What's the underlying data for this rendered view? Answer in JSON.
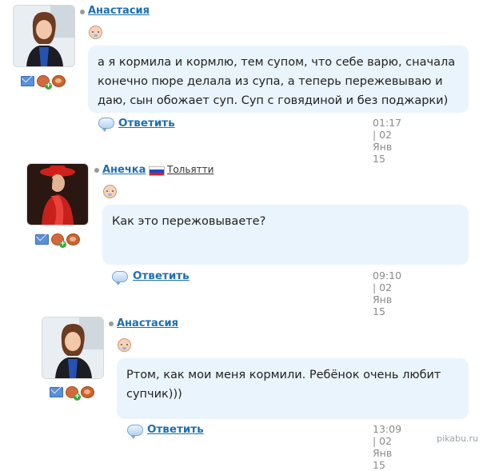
{
  "colors": {
    "link": "#1e6fb0",
    "bubble": "#eaf4fc",
    "meta": "#8a8a8a"
  },
  "posts": [
    {
      "author": "Анастасия",
      "avatar_icon": "avatar-photo-icon",
      "text": "а я кормила и кормлю, тем супом, что себе варю, сначала конечно пюре делала из супа, а теперь пережевываю и даю, сын обожает суп. Суп с говядиной и без поджарки)",
      "reply_label": "Ответить",
      "timestamp": "01:17 | 02 Янв 15"
    },
    {
      "author": "Анечка",
      "city": "Тольятти",
      "avatar_icon": "avatar-photo-icon",
      "text": "Как это пережовываете?",
      "reply_label": "Ответить",
      "timestamp": "09:10 | 02 Янв 15"
    },
    {
      "author": "Анастасия",
      "avatar_icon": "avatar-photo-icon",
      "text": "Ртом, как мои меня кормили. Ребёнок очень любит супчик)))",
      "reply_label": "Ответить",
      "timestamp": "13:09 | 02 Янв 15"
    }
  ],
  "watermark": "pikabu.ru"
}
